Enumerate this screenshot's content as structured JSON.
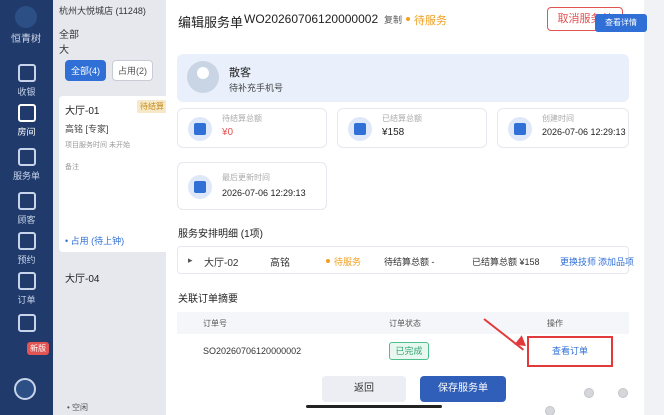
{
  "leftnav": {
    "logo_text": "恒青树",
    "items": [
      {
        "label": "收银",
        "icon": "monitor-icon"
      },
      {
        "label": "房间",
        "icon": "home-icon"
      },
      {
        "label": "服务单",
        "icon": "service-list-icon"
      },
      {
        "label": "顾客",
        "icon": "customer-icon"
      },
      {
        "label": "预约",
        "icon": "calendar-icon"
      },
      {
        "label": "订单",
        "icon": "order-icon"
      },
      {
        "label": "",
        "icon": "staff-icon"
      }
    ],
    "badge": "新版"
  },
  "behind": {
    "store": "杭州大悦城店  (11248)",
    "tab_all": "全部",
    "tab_other": "大",
    "chip_all": "全部(4)",
    "chip_occupied": "占用(2)",
    "room1": "大厅-01",
    "room1_tag": "待结算",
    "room1_tech": "高铭 [专家]",
    "room1_desc": "项目服务时间 未开始",
    "room1_note": "备注",
    "room1_status": "• 占用 (待上钟)",
    "room2": "大厅-04",
    "idle": "• 空闲"
  },
  "modal": {
    "title": "编辑服务单",
    "order_no": "WO20260706120000002",
    "copy": "复制",
    "status": "待服务",
    "cancel": "取消服务单",
    "close": "✕",
    "customer": {
      "name": "散客",
      "phone": "待补充手机号",
      "detail_btn": "查看详情"
    },
    "stats": [
      {
        "label": "待结算总额",
        "value": "¥0",
        "icon": "clock-wallet-icon"
      },
      {
        "label": "已结算总额",
        "value": "¥158",
        "icon": "wallet-check-icon"
      },
      {
        "label": "创建时间",
        "value": "2026-07-06 12:29:13",
        "icon": "clock-icon"
      },
      {
        "label": "最后更新时间",
        "value": "2026-07-06 12:29:13",
        "icon": "refresh-icon"
      }
    ],
    "service_section": "服务安排明细 (1项)",
    "service_row": {
      "room": "大厅-02",
      "tech": "高铭",
      "status": "待服务",
      "pending": "待结算总额 -",
      "settled": "已结算总额 ¥158",
      "change": "更换技师",
      "add": "添加品项"
    },
    "order_section": "关联订单摘要",
    "table": {
      "headers": [
        "订单号",
        "订单状态",
        "操作"
      ],
      "row": {
        "order_no": "SO20260706120000002",
        "status": "已完成",
        "action": "查看订单"
      }
    },
    "back": "返回",
    "save": "保存服务单"
  },
  "colors": {
    "primary": "#2f6fd6",
    "danger": "#e25353",
    "warning": "#f0a020",
    "success": "#2da46f",
    "nav_bg": "#1f3a6b"
  }
}
